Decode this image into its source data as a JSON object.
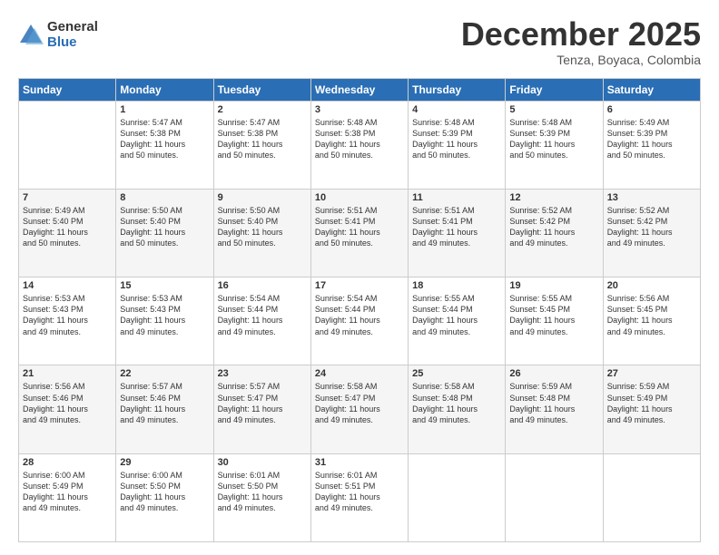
{
  "logo": {
    "general": "General",
    "blue": "Blue"
  },
  "title": "December 2025",
  "subtitle": "Tenza, Boyaca, Colombia",
  "header_days": [
    "Sunday",
    "Monday",
    "Tuesday",
    "Wednesday",
    "Thursday",
    "Friday",
    "Saturday"
  ],
  "weeks": [
    [
      {
        "day": "",
        "info": ""
      },
      {
        "day": "1",
        "info": "Sunrise: 5:47 AM\nSunset: 5:38 PM\nDaylight: 11 hours\nand 50 minutes."
      },
      {
        "day": "2",
        "info": "Sunrise: 5:47 AM\nSunset: 5:38 PM\nDaylight: 11 hours\nand 50 minutes."
      },
      {
        "day": "3",
        "info": "Sunrise: 5:48 AM\nSunset: 5:38 PM\nDaylight: 11 hours\nand 50 minutes."
      },
      {
        "day": "4",
        "info": "Sunrise: 5:48 AM\nSunset: 5:39 PM\nDaylight: 11 hours\nand 50 minutes."
      },
      {
        "day": "5",
        "info": "Sunrise: 5:48 AM\nSunset: 5:39 PM\nDaylight: 11 hours\nand 50 minutes."
      },
      {
        "day": "6",
        "info": "Sunrise: 5:49 AM\nSunset: 5:39 PM\nDaylight: 11 hours\nand 50 minutes."
      }
    ],
    [
      {
        "day": "7",
        "info": "Sunrise: 5:49 AM\nSunset: 5:40 PM\nDaylight: 11 hours\nand 50 minutes."
      },
      {
        "day": "8",
        "info": "Sunrise: 5:50 AM\nSunset: 5:40 PM\nDaylight: 11 hours\nand 50 minutes."
      },
      {
        "day": "9",
        "info": "Sunrise: 5:50 AM\nSunset: 5:40 PM\nDaylight: 11 hours\nand 50 minutes."
      },
      {
        "day": "10",
        "info": "Sunrise: 5:51 AM\nSunset: 5:41 PM\nDaylight: 11 hours\nand 50 minutes."
      },
      {
        "day": "11",
        "info": "Sunrise: 5:51 AM\nSunset: 5:41 PM\nDaylight: 11 hours\nand 49 minutes."
      },
      {
        "day": "12",
        "info": "Sunrise: 5:52 AM\nSunset: 5:42 PM\nDaylight: 11 hours\nand 49 minutes."
      },
      {
        "day": "13",
        "info": "Sunrise: 5:52 AM\nSunset: 5:42 PM\nDaylight: 11 hours\nand 49 minutes."
      }
    ],
    [
      {
        "day": "14",
        "info": "Sunrise: 5:53 AM\nSunset: 5:43 PM\nDaylight: 11 hours\nand 49 minutes."
      },
      {
        "day": "15",
        "info": "Sunrise: 5:53 AM\nSunset: 5:43 PM\nDaylight: 11 hours\nand 49 minutes."
      },
      {
        "day": "16",
        "info": "Sunrise: 5:54 AM\nSunset: 5:44 PM\nDaylight: 11 hours\nand 49 minutes."
      },
      {
        "day": "17",
        "info": "Sunrise: 5:54 AM\nSunset: 5:44 PM\nDaylight: 11 hours\nand 49 minutes."
      },
      {
        "day": "18",
        "info": "Sunrise: 5:55 AM\nSunset: 5:44 PM\nDaylight: 11 hours\nand 49 minutes."
      },
      {
        "day": "19",
        "info": "Sunrise: 5:55 AM\nSunset: 5:45 PM\nDaylight: 11 hours\nand 49 minutes."
      },
      {
        "day": "20",
        "info": "Sunrise: 5:56 AM\nSunset: 5:45 PM\nDaylight: 11 hours\nand 49 minutes."
      }
    ],
    [
      {
        "day": "21",
        "info": "Sunrise: 5:56 AM\nSunset: 5:46 PM\nDaylight: 11 hours\nand 49 minutes."
      },
      {
        "day": "22",
        "info": "Sunrise: 5:57 AM\nSunset: 5:46 PM\nDaylight: 11 hours\nand 49 minutes."
      },
      {
        "day": "23",
        "info": "Sunrise: 5:57 AM\nSunset: 5:47 PM\nDaylight: 11 hours\nand 49 minutes."
      },
      {
        "day": "24",
        "info": "Sunrise: 5:58 AM\nSunset: 5:47 PM\nDaylight: 11 hours\nand 49 minutes."
      },
      {
        "day": "25",
        "info": "Sunrise: 5:58 AM\nSunset: 5:48 PM\nDaylight: 11 hours\nand 49 minutes."
      },
      {
        "day": "26",
        "info": "Sunrise: 5:59 AM\nSunset: 5:48 PM\nDaylight: 11 hours\nand 49 minutes."
      },
      {
        "day": "27",
        "info": "Sunrise: 5:59 AM\nSunset: 5:49 PM\nDaylight: 11 hours\nand 49 minutes."
      }
    ],
    [
      {
        "day": "28",
        "info": "Sunrise: 6:00 AM\nSunset: 5:49 PM\nDaylight: 11 hours\nand 49 minutes."
      },
      {
        "day": "29",
        "info": "Sunrise: 6:00 AM\nSunset: 5:50 PM\nDaylight: 11 hours\nand 49 minutes."
      },
      {
        "day": "30",
        "info": "Sunrise: 6:01 AM\nSunset: 5:50 PM\nDaylight: 11 hours\nand 49 minutes."
      },
      {
        "day": "31",
        "info": "Sunrise: 6:01 AM\nSunset: 5:51 PM\nDaylight: 11 hours\nand 49 minutes."
      },
      {
        "day": "",
        "info": ""
      },
      {
        "day": "",
        "info": ""
      },
      {
        "day": "",
        "info": ""
      }
    ]
  ]
}
